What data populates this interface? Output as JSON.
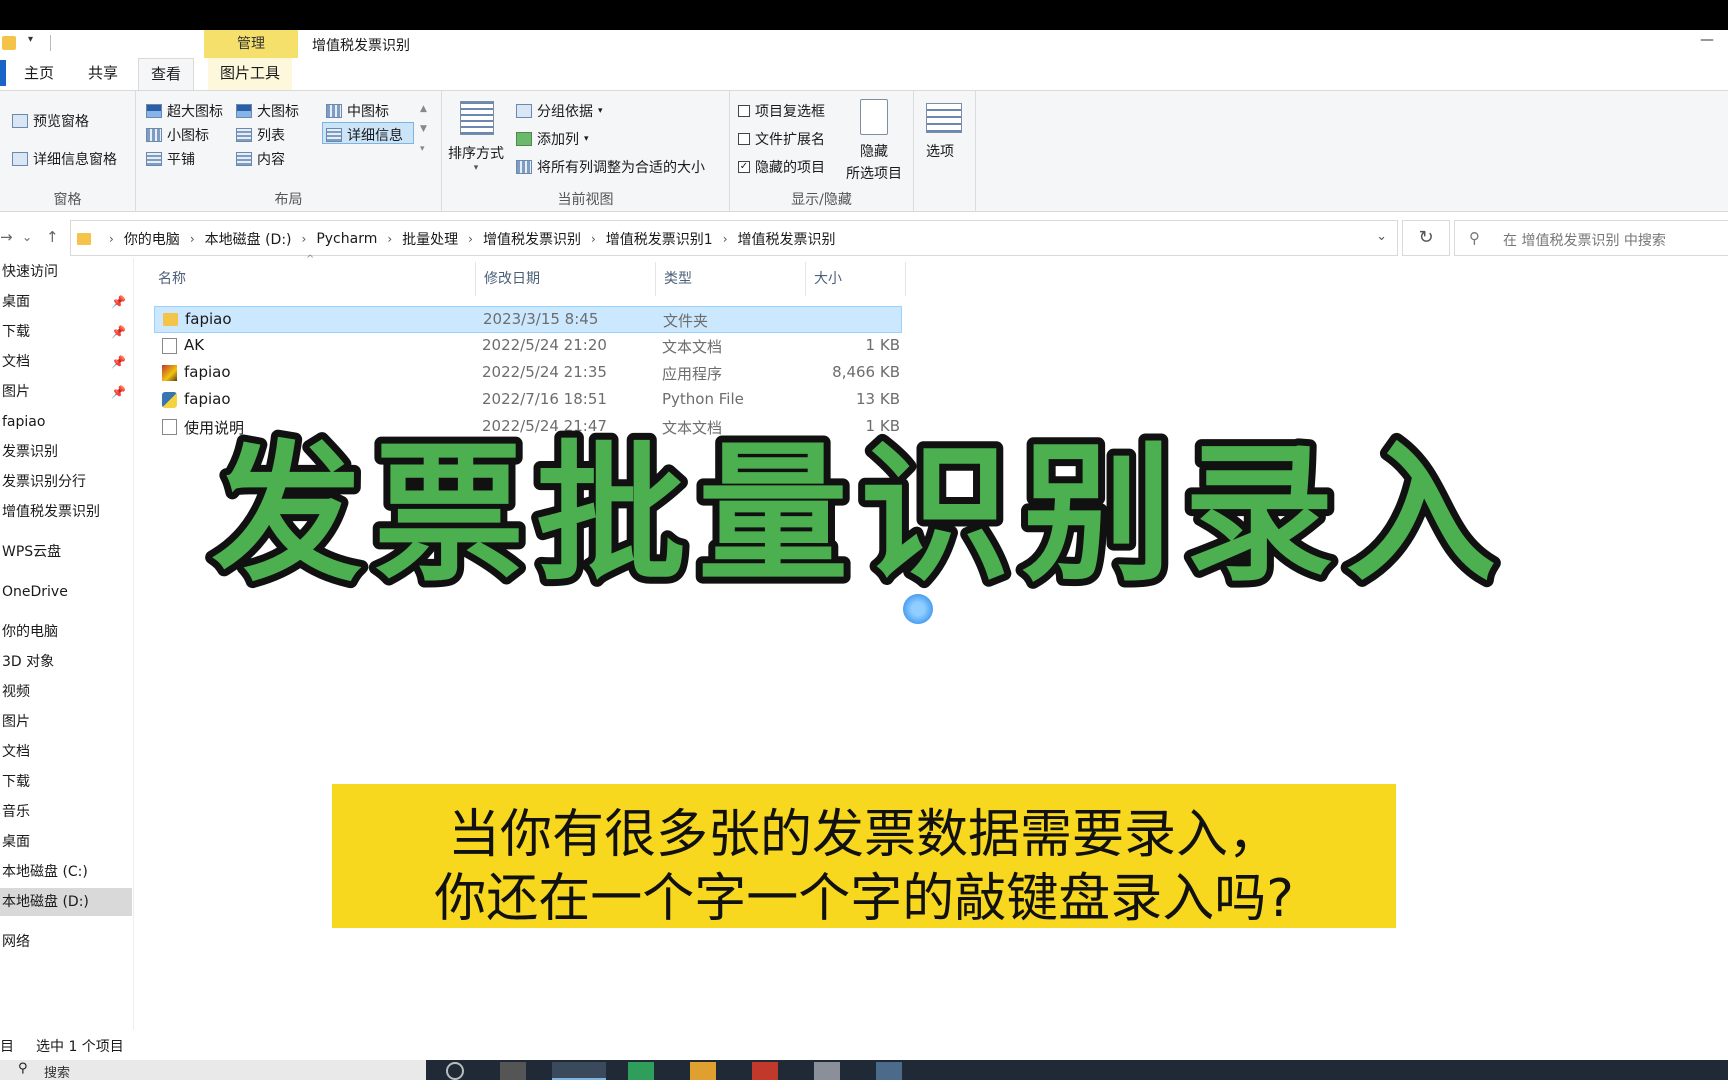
{
  "window": {
    "title": "增值税发票识别",
    "context_tab": "管理"
  },
  "tabs": [
    {
      "label": "主页"
    },
    {
      "label": "共享"
    },
    {
      "label": "查看"
    },
    {
      "label": "图片工具"
    }
  ],
  "ribbon": {
    "pane": {
      "label": "窗格",
      "preview": "预览窗格",
      "details": "详细信息窗格"
    },
    "layout": {
      "label": "布局",
      "items": [
        "超大图标",
        "大图标",
        "中图标",
        "小图标",
        "列表",
        "详细信息",
        "平铺",
        "内容"
      ]
    },
    "current_view": {
      "label": "当前视图",
      "sort": "排序方式",
      "group": "分组依据",
      "add_column": "添加列",
      "fit_columns": "将所有列调整为合适的大小"
    },
    "show_hide": {
      "label": "显示/隐藏",
      "item_checkboxes": "项目复选框",
      "file_extensions": "文件扩展名",
      "hidden_items": "隐藏的项目",
      "hide_selected_line1": "隐藏",
      "hide_selected_line2": "所选项目",
      "checks": {
        "item_checkboxes": false,
        "file_extensions": false,
        "hidden_items": true
      }
    },
    "options": "选项"
  },
  "address": {
    "crumbs": [
      "你的电脑",
      "本地磁盘 (D:)",
      "Pycharm",
      "批量处理",
      "增值税发票识别",
      "增值税发票识别1",
      "增值税发票识别"
    ],
    "search_placeholder": "在 增值税发票识别 中搜索"
  },
  "sidebar": {
    "items": [
      {
        "label": "快速访问"
      },
      {
        "label": "桌面",
        "pinned": true
      },
      {
        "label": "下载",
        "pinned": true
      },
      {
        "label": "文档",
        "pinned": true
      },
      {
        "label": "图片",
        "pinned": true
      },
      {
        "label": "fapiao"
      },
      {
        "label": "发票识别"
      },
      {
        "label": "发票识别分行"
      },
      {
        "label": "增值税发票识别"
      },
      {
        "label": "WPS云盘"
      },
      {
        "label": "OneDrive"
      },
      {
        "label": "你的电脑"
      },
      {
        "label": "3D 对象"
      },
      {
        "label": "视频"
      },
      {
        "label": "图片"
      },
      {
        "label": "文档"
      },
      {
        "label": "下载"
      },
      {
        "label": "音乐"
      },
      {
        "label": "桌面"
      },
      {
        "label": "本地磁盘 (C:)"
      },
      {
        "label": "本地磁盘 (D:)",
        "selected": true
      },
      {
        "label": "网络"
      }
    ]
  },
  "columns": [
    "名称",
    "修改日期",
    "类型",
    "大小"
  ],
  "files": [
    {
      "name": "fapiao",
      "date": "2023/3/15 8:45",
      "type": "文件夹",
      "size": "",
      "icon": "folder-icon",
      "selected": true
    },
    {
      "name": "AK",
      "date": "2022/5/24 21:20",
      "type": "文本文档",
      "size": "1 KB",
      "icon": "text-file-icon"
    },
    {
      "name": "fapiao",
      "date": "2022/5/24 21:35",
      "type": "应用程序",
      "size": "8,466 KB",
      "icon": "application-icon"
    },
    {
      "name": "fapiao",
      "date": "2022/7/16 18:51",
      "type": "Python File",
      "size": "13 KB",
      "icon": "python-file-icon"
    },
    {
      "name": "使用说明",
      "date": "2022/5/24 21:47",
      "type": "文本文档",
      "size": "1 KB",
      "icon": "text-file-icon"
    }
  ],
  "overlay": {
    "title": "发票批量识别录入",
    "caption_line1": "当你有很多张的发票数据需要录入，",
    "caption_line2": "你还在一个字一个字的敲键盘录入吗?"
  },
  "status": {
    "left": "目",
    "selected": "选中 1 个项目"
  },
  "taskbar": {
    "search_text": "搜索"
  },
  "colors": {
    "overlay_fill": "#4caf50",
    "overlay_outline": "#111111",
    "caption_bg": "#f7d81e",
    "selection": "#cce8ff",
    "manage_tab": "#f5e06b"
  }
}
